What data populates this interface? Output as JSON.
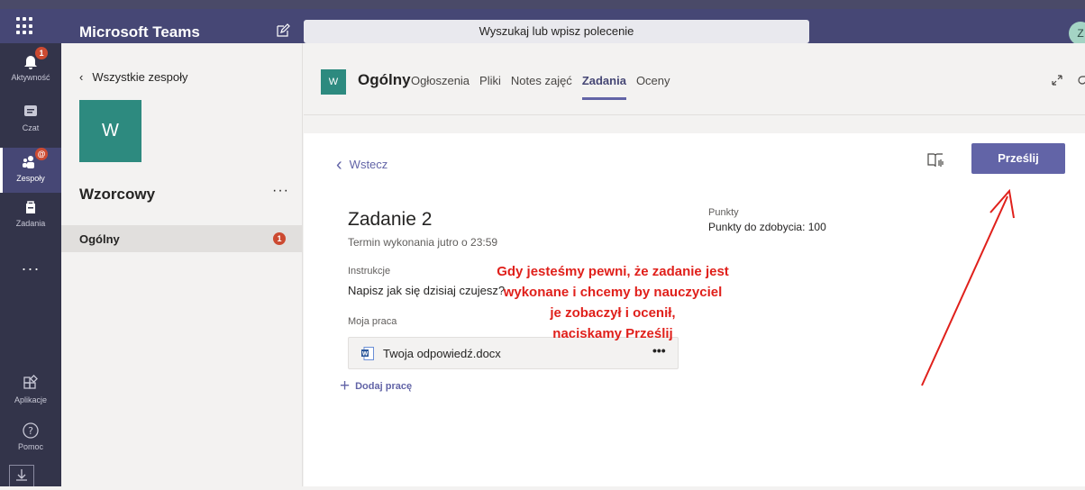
{
  "app": {
    "title": "Microsoft Teams",
    "search_placeholder": "Wyszukaj lub wpisz polecenie",
    "user_initial": "Z"
  },
  "rail": {
    "items": [
      {
        "label": "Aktywność",
        "icon": "bell-icon",
        "badge": "1"
      },
      {
        "label": "Czat",
        "icon": "chat-icon"
      },
      {
        "label": "Zespoły",
        "icon": "teams-icon",
        "badge": "@"
      },
      {
        "label": "Zadania",
        "icon": "assignments-icon"
      },
      {
        "label": "···",
        "icon": "more-icon"
      },
      {
        "label": "Aplikacje",
        "icon": "apps-icon"
      },
      {
        "label": "Pomoc",
        "icon": "help-icon"
      }
    ]
  },
  "team_pane": {
    "back_label": "Wszystkie zespoły",
    "tile_letter": "W",
    "team_name": "Wzorcowy",
    "more": "···",
    "channel": {
      "name": "Ogólny",
      "badge": "1"
    }
  },
  "channel_header": {
    "tile_letter": "W",
    "title": "Ogólny",
    "tabs": [
      {
        "label": "Ogłoszenia",
        "active": false
      },
      {
        "label": "Pliki",
        "active": false
      },
      {
        "label": "Notes zajęć",
        "active": false
      },
      {
        "label": "Zadania",
        "active": true
      },
      {
        "label": "Oceny",
        "active": false
      }
    ]
  },
  "assignment": {
    "back_label": "Wstecz",
    "submit_label": "Prześlij",
    "title": "Zadanie 2",
    "due": "Termin wykonania jutro o 23:59",
    "points_label": "Punkty",
    "points_value": "Punkty do zdobycia: 100",
    "instructions_label": "Instrukcje",
    "instructions_text": "Napisz jak się dzisiaj czujesz?",
    "my_work_label": "Moja praca",
    "file_name": "Twoja odpowiedź.docx",
    "file_more": "•••",
    "add_work_label": "Dodaj pracę"
  },
  "annotation": {
    "lines": [
      "Gdy jesteśmy pewni, że zadanie jest",
      "wykonane i chcemy by nauczyciel",
      "je zobaczył i ocenił,",
      "naciskamy Prześlij"
    ],
    "color": "#e0201b"
  },
  "colors": {
    "brand": "#464775",
    "accent": "#6264a7",
    "team_tile": "#2d8a7f",
    "badge": "#cc4a31"
  }
}
